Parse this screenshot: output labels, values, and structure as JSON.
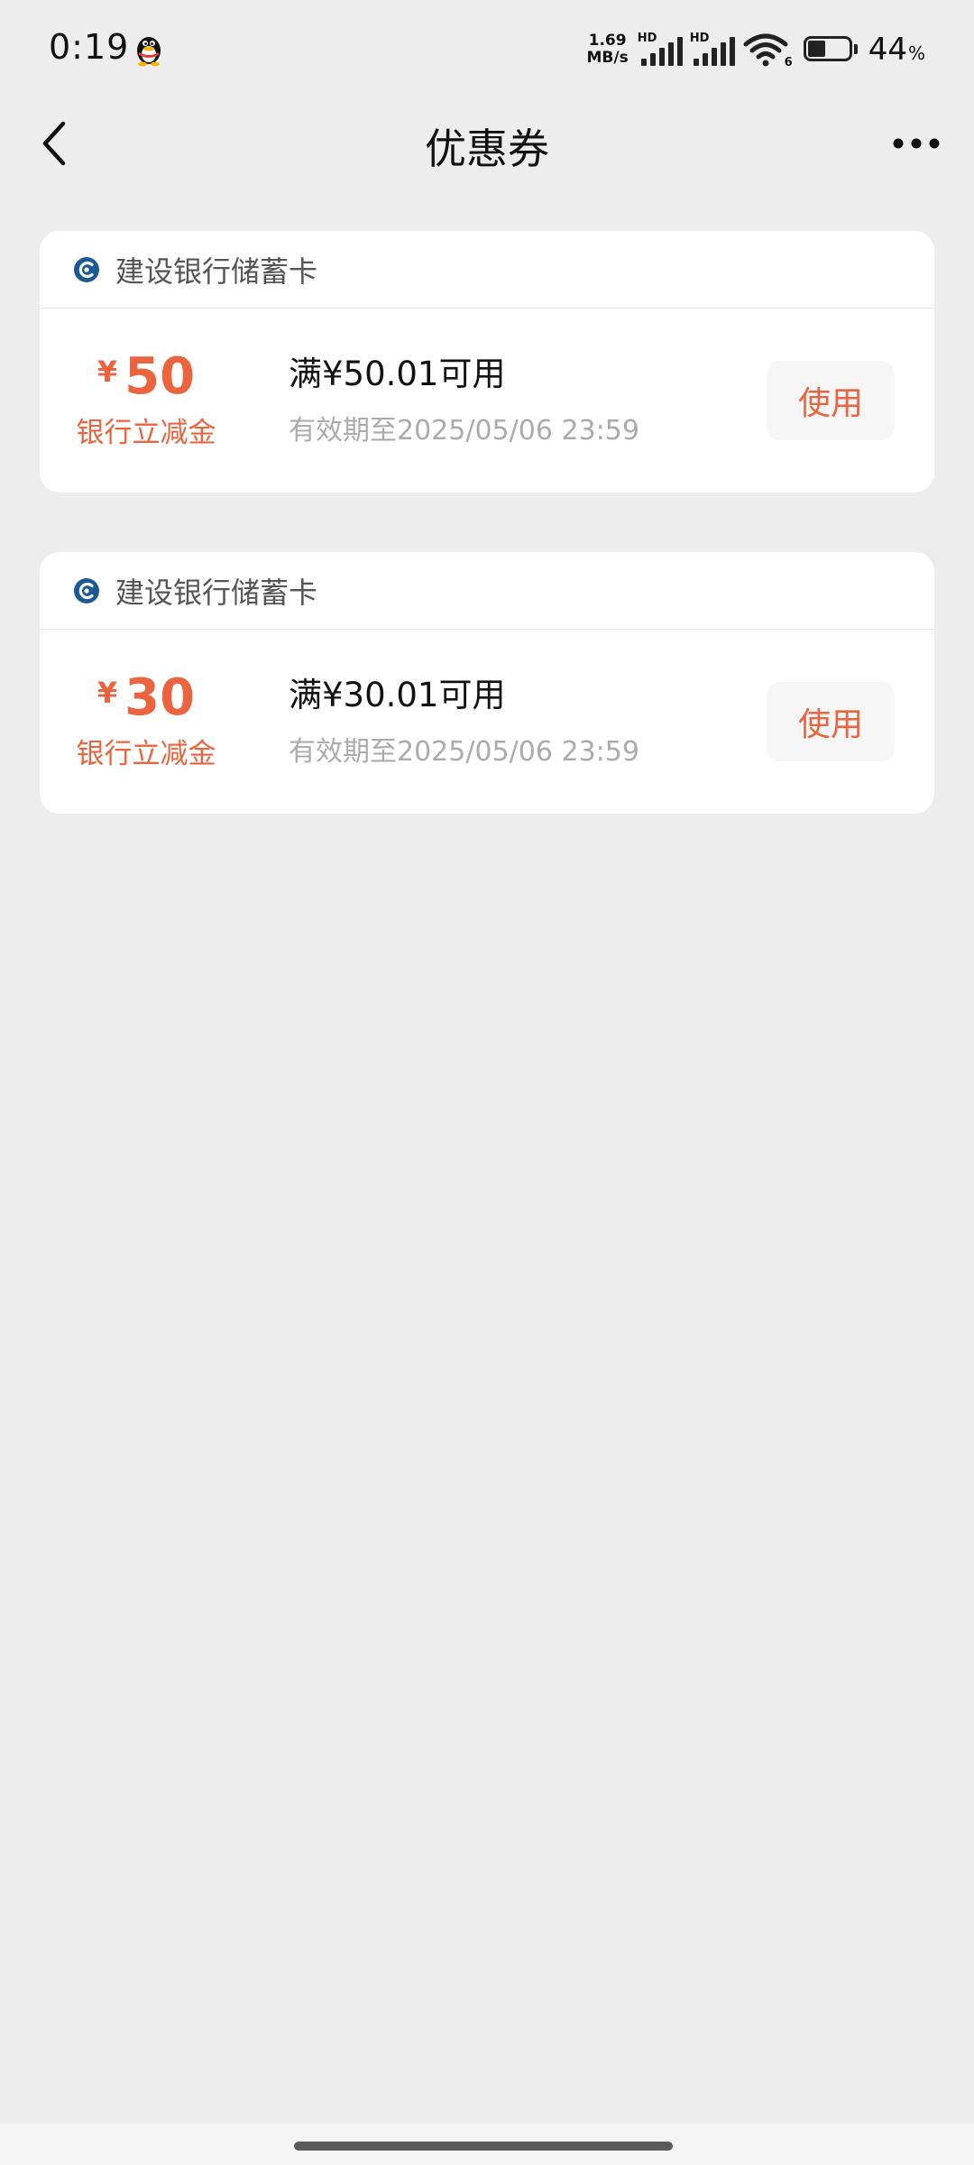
{
  "status_bar": {
    "time": "0:19",
    "net_speed_value": "1.69",
    "net_speed_unit": "MB/s",
    "sim1_label": "HD",
    "sim2_label": "HD",
    "wifi_generation": "6",
    "battery_level": 0.44,
    "battery_number": "44",
    "battery_unit": "%"
  },
  "nav": {
    "title": "优惠券"
  },
  "coupons": [
    {
      "bank_name": "建设银行储蓄卡",
      "currency_symbol": "¥",
      "amount": "50",
      "amount_label": "银行立减金",
      "condition": "满¥50.01可用",
      "validity": "有效期至2025/05/06 23:59",
      "button_label": "使用"
    },
    {
      "bank_name": "建设银行储蓄卡",
      "currency_symbol": "¥",
      "amount": "30",
      "amount_label": "银行立减金",
      "condition": "满¥30.01可用",
      "validity": "有效期至2025/05/06 23:59",
      "button_label": "使用"
    }
  ],
  "colors": {
    "accent": "#E9643F",
    "background": "#EDEDED",
    "card": "#FFFFFF",
    "bank_logo": "#1D5A94"
  }
}
